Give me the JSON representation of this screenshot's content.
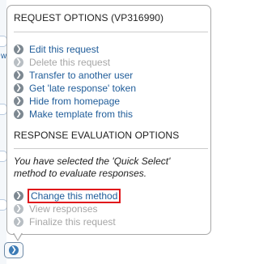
{
  "background": {
    "edge_text": "w"
  },
  "request_options": {
    "title": "REQUEST OPTIONS (VP316990)",
    "items": [
      {
        "label": "Edit this request",
        "enabled": true
      },
      {
        "label": "Delete this request",
        "enabled": false
      },
      {
        "label": "Transfer to another user",
        "enabled": true
      },
      {
        "label": "Get 'late response' token",
        "enabled": true
      },
      {
        "label": "Hide from homepage",
        "enabled": true
      },
      {
        "label": "Make template from this",
        "enabled": true
      }
    ]
  },
  "evaluation_options": {
    "title": "RESPONSE EVALUATION OPTIONS",
    "message": "You have selected the 'Quick Select' method to evaluate responses.",
    "items": [
      {
        "label": "Change this method",
        "enabled": true,
        "highlighted": true
      },
      {
        "label": "View responses",
        "enabled": false
      },
      {
        "label": "Finalize this request",
        "enabled": false
      }
    ]
  },
  "icons": {
    "bullet": "arrow-right-circle-icon",
    "toggle": "chevron-right-icon"
  },
  "colors": {
    "link": "#1f5c99",
    "disabled": "#a6a6a6",
    "highlight_border": "#e0161b",
    "bullet": "#7d8891"
  }
}
